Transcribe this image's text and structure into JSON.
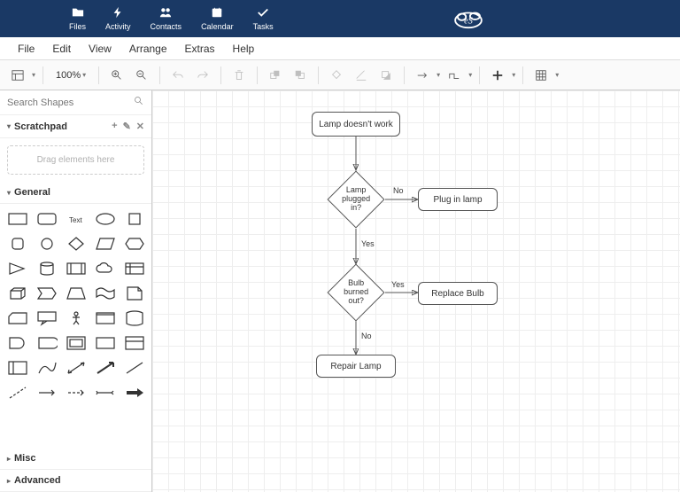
{
  "topbar": {
    "apps": [
      {
        "icon": "folder",
        "label": "Files"
      },
      {
        "icon": "bolt",
        "label": "Activity"
      },
      {
        "icon": "users",
        "label": "Contacts"
      },
      {
        "icon": "calendar",
        "label": "Calendar"
      },
      {
        "icon": "check",
        "label": "Tasks"
      }
    ],
    "brand": "eS"
  },
  "menu": [
    "File",
    "Edit",
    "View",
    "Arrange",
    "Extras",
    "Help"
  ],
  "toolbar": {
    "zoom": "100%"
  },
  "sidebar": {
    "search_placeholder": "Search Shapes",
    "scratchpad": {
      "title": "Scratchpad",
      "hint": "Drag elements here"
    },
    "sections": {
      "general": "General",
      "misc": "Misc",
      "advanced": "Advanced"
    }
  },
  "flow": {
    "start": "Lamp doesn't work",
    "d1": "Lamp plugged in?",
    "d1_no": "No",
    "d1_yes": "Yes",
    "a1": "Plug in lamp",
    "d2": "Bulb burned out?",
    "d2_yes": "Yes",
    "d2_no": "No",
    "a2": "Replace Bulb",
    "a3": "Repair Lamp"
  }
}
